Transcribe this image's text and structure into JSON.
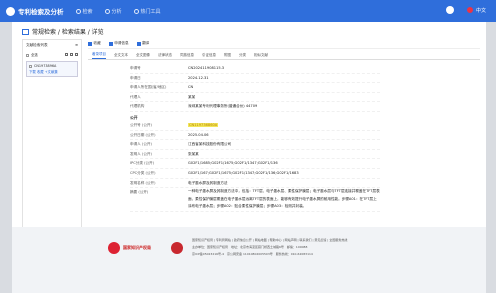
{
  "topbar": {
    "title": "专利检索及分析",
    "nav": [
      "检索",
      "分析",
      "热门工具"
    ],
    "user_badge": "中文"
  },
  "breadcrumb": "常规检索 / 检索结果 / 详览",
  "sidebar": {
    "header": "文献检索列表",
    "row_label": "全选",
    "item_id": "CN1973896A",
    "item_meta": "下载 收藏 +文献集"
  },
  "toolbar": [
    "收藏",
    "申请信息",
    "翻译"
  ],
  "tabs": [
    "著录项目",
    "全文文本",
    "全文图像",
    "法律状态",
    "同族信息",
    "引证信息",
    "附图",
    "分类",
    "相似文献"
  ],
  "section_title": "公开",
  "fields": [
    {
      "k": "申请号",
      "v": "CN202411908115.3"
    },
    {
      "k": "申请日",
      "v": "2024.12.31"
    },
    {
      "k": "申请人所在国(省/地区)",
      "v": "CN"
    },
    {
      "k": "代理人",
      "v": "某某"
    },
    {
      "k": "代理机构",
      "v": "深圳某某专利代理事务所(普通合伙) 44709"
    }
  ],
  "pub_fields": [
    {
      "k": "公开号 (公开)",
      "v": "CN119736860A",
      "highlight": true
    },
    {
      "k": "公开日期 (公开)",
      "v": "2025.04.06"
    },
    {
      "k": "申请人 (公开)",
      "v": "江西省某科技股份有限公司"
    },
    {
      "k": "发明人 (公开)",
      "v": "张某某"
    },
    {
      "k": "IPC分类 (公开)",
      "v": "G02F1/1685;G02F1/1675;G02F1/1347;G02F1/136"
    },
    {
      "k": "CPC分类 (公开)",
      "v": "G02F1/167;G02F1/1675;G02F1/1347;G02F1/136;G02F1/1683"
    },
    {
      "k": "发明名称 (公开)",
      "v": "电子墨水屏及其制造方法"
    },
    {
      "k": "摘要 (公开)",
      "v": "一种电子墨水屏及其制造方法中，包括：TFT层、电子墨水层、柔性保护膜层；电子墨水层与TFT层连接并覆盖在TFT层表面，柔性保护膜层覆盖在电子墨水层远离TFT层的表面上，能够有效提升电子墨水屏的耐用性能。步骤A01：在TFT层上涂布电子墨水层；步骤A02：贴合柔性保护膜层；步骤A03：检测并封装。"
    }
  ],
  "footer": {
    "logo_text": "国家知识产权局",
    "links": "国家知识产权局 | 专利局网站 | 政府信息公开 | 网站地图 | 帮助中心 | 网站声明 | 联系我们 | 意见反馈 | 全国服务热线",
    "address": "主办单位：国家知识产权局　地址：北京市海淀区蓟门桥西土城路6号　邮编：100088",
    "icp": "京ICP备05023216号-4　京公网安备 11010802005503号　服务热线：010-62083114"
  }
}
